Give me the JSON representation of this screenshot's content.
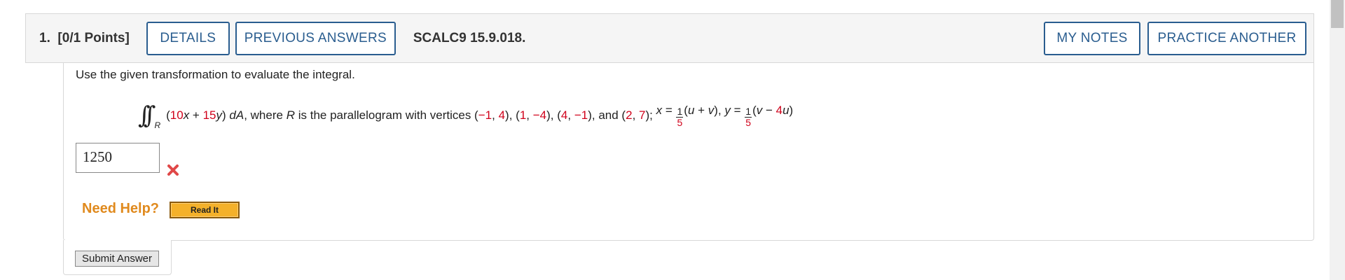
{
  "question": {
    "number_label": "1.",
    "points_label": "[0/1 Points]",
    "details_label": "DETAILS",
    "previous_answers_label": "PREVIOUS ANSWERS",
    "reference": "SCALC9 15.9.018.",
    "my_notes_label": "MY NOTES",
    "practice_another_label": "PRACTICE ANOTHER"
  },
  "body": {
    "prompt": "Use the given transformation to evaluate the integral.",
    "integral": {
      "symbol": "∫∫",
      "region": "R",
      "coef_x": "10",
      "coef_y": "15",
      "var_x": "x",
      "var_y": "y",
      "differential": "dA",
      "where_text": "where",
      "region_text": "R",
      "is_text": "is the parallelogram with vertices",
      "v1": [
        "−1",
        "4"
      ],
      "v2": [
        "1",
        "−4"
      ],
      "v3": [
        "4",
        "−1"
      ],
      "v4": [
        "2",
        "7"
      ],
      "and_text": "and",
      "frac_num": "1",
      "frac_den": "5",
      "coef_u": "4",
      "var_u": "u",
      "var_v": "v"
    },
    "answer_value": "1250",
    "need_help_label": "Need Help?",
    "read_it_label": "Read It",
    "submit_label": "Submit Answer"
  },
  "colors": {
    "button_blue": "#2a5d8f",
    "given_value_red": "#d0021b",
    "help_orange": "#e08a1e",
    "wrong_mark": "#e04848"
  }
}
